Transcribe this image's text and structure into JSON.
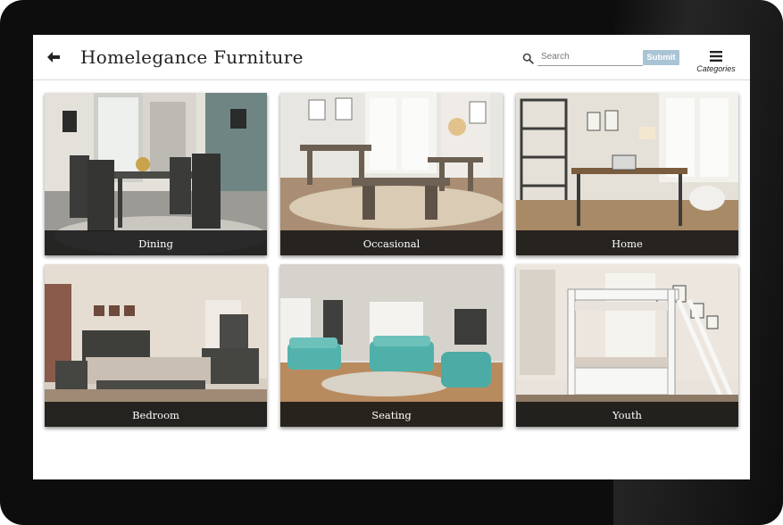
{
  "header": {
    "title": "Homelegance Furniture",
    "search_placeholder": "Search",
    "submit_label": "Submit",
    "menu_label": "Categories"
  },
  "icons": {
    "back": "left-arrow-icon",
    "search": "magnifier-icon",
    "menu": "hamburger-menu-icon"
  },
  "categories": [
    {
      "label": "Dining"
    },
    {
      "label": "Occasional"
    },
    {
      "label": "Home"
    },
    {
      "label": "Bedroom"
    },
    {
      "label": "Seating"
    },
    {
      "label": "Youth"
    }
  ],
  "colors": {
    "submit_button": "#a9c4d4",
    "label_bar": "#141414"
  }
}
